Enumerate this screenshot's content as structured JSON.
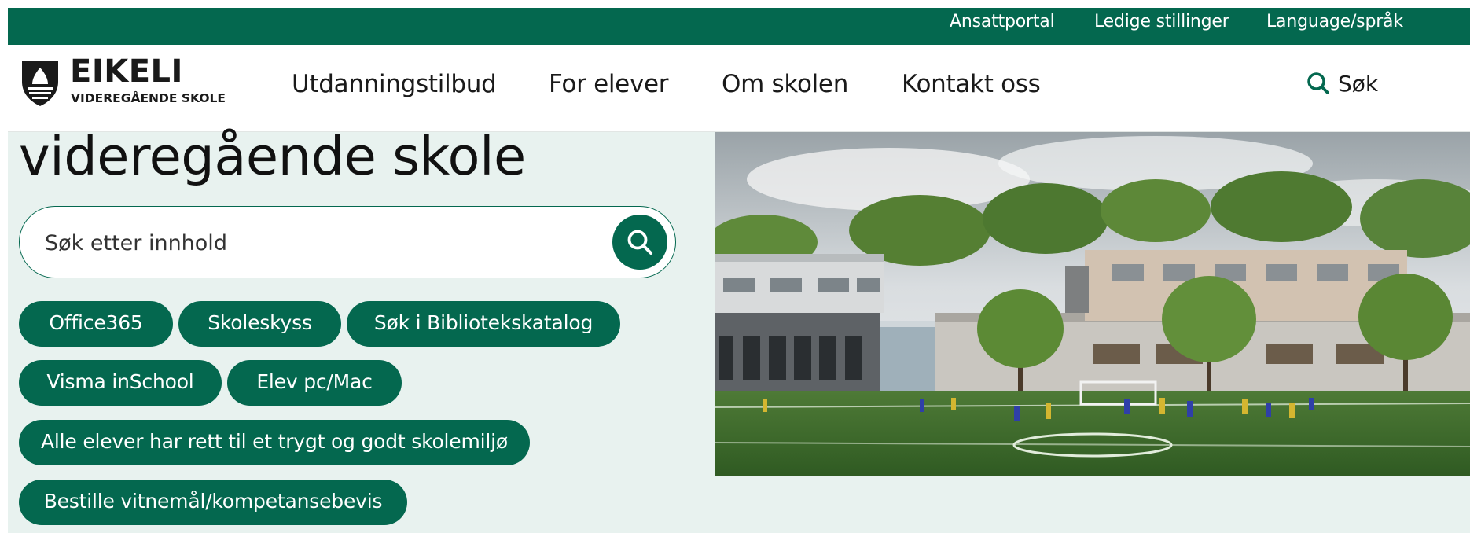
{
  "utility_nav": {
    "links": [
      {
        "label": "Ansattportal"
      },
      {
        "label": "Ledige stillinger"
      },
      {
        "label": "Language/språk"
      }
    ]
  },
  "header": {
    "logo": {
      "title": "EIKELI",
      "subtitle": "VIDEREGÅENDE SKOLE"
    },
    "nav": [
      {
        "label": "Utdanningstilbud"
      },
      {
        "label": "For elever"
      },
      {
        "label": "Om skolen"
      },
      {
        "label": "Kontakt oss"
      }
    ],
    "search_label": "Søk"
  },
  "main": {
    "title": "videregående skole",
    "search": {
      "placeholder": "Søk etter innhold"
    },
    "quick_links": [
      {
        "label": "Office365"
      },
      {
        "label": "Skoleskyss"
      },
      {
        "label": "Søk i Bibliotekskatalog"
      },
      {
        "label": "Visma inSchool"
      },
      {
        "label": "Elev pc/Mac"
      },
      {
        "label": "Alle elever har rett til et trygt og godt skolemiljø"
      },
      {
        "label": "Bestille vitnemål/kompetansebevis"
      }
    ]
  },
  "colors": {
    "brand_green": "#04684f",
    "background_mint": "#e8f2ef",
    "text_dark": "#111111"
  },
  "icons": {
    "logo": "shield-logo-icon",
    "search": "search-icon"
  }
}
